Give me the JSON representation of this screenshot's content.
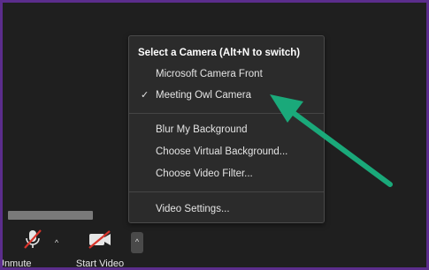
{
  "camera_menu": {
    "header": "Select a Camera (Alt+N to switch)",
    "cameras": [
      {
        "label": "Microsoft Camera Front",
        "selected": false
      },
      {
        "label": "Meeting Owl Camera",
        "selected": true
      }
    ],
    "check_glyph": "✓",
    "background_options": [
      {
        "label": "Blur My Background"
      },
      {
        "label": "Choose Virtual Background..."
      },
      {
        "label": "Choose Video Filter..."
      }
    ],
    "settings_label": "Video Settings..."
  },
  "toolbar": {
    "mute_label": "Unmute",
    "mute_icon": "microphone-muted-icon",
    "video_label": "Start Video",
    "video_icon": "video-camera-off-icon",
    "caret_glyph": "^"
  },
  "colors": {
    "frame_border": "#5b2d8c",
    "menu_background": "#2b2b2b",
    "annotation_arrow": "#1aa97a",
    "muted_slash": "#d9342b"
  }
}
